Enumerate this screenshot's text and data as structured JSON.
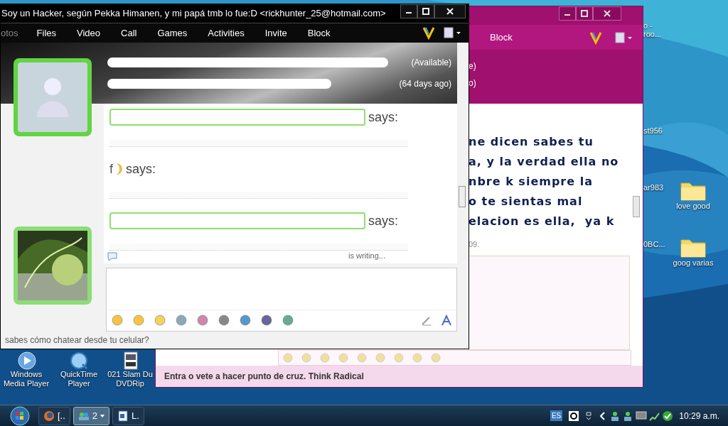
{
  "desktop_icons_right": [
    {
      "label": "o -\nroo...",
      "kind": "partial"
    },
    {
      "label": "st956",
      "kind": "partial"
    },
    {
      "label": "ar983",
      "kind": "partial"
    },
    {
      "label": "love good",
      "kind": "folder"
    },
    {
      "label": "0BC...",
      "kind": "partial"
    },
    {
      "label": "goog varias",
      "kind": "folder"
    }
  ],
  "desktop_icons_left": [
    {
      "label": "Windows Media Player",
      "kind": "media"
    },
    {
      "label": "QuickTime Player",
      "kind": "quicktime"
    },
    {
      "label": "021 Slam Du DVDRip",
      "kind": "video"
    }
  ],
  "back_window": {
    "menu": [
      "Block"
    ],
    "status_lines": [
      "e)",
      "o)"
    ],
    "message_lines": [
      "ne dicen sabes tu",
      "a, y la verdad ella no",
      "nbre k siempre la",
      "o te sientas mal",
      "elacion es ella,  ya k"
    ],
    "timestamp": "09.",
    "footer": "Entra o vete a hacer punto de cruz. Think Radical"
  },
  "front_window": {
    "title": "Soy un Hacker, según Pekka Himanen, y mi papá tmb lo fue:D <rickhunter_25@hotmail.com>",
    "menu": [
      {
        "label": "otos"
      },
      {
        "label": "Files"
      },
      {
        "label": "Video"
      },
      {
        "label": "Call"
      },
      {
        "label": "Games"
      },
      {
        "label": "Activities"
      },
      {
        "label": "Invite"
      },
      {
        "label": "Block"
      }
    ],
    "contact_status": "(Available)",
    "last_seen": "(64 days ago)",
    "messages": [
      {
        "says": "says:",
        "highlight": true
      },
      {
        "prefix": "f",
        "says": "says:",
        "highlight": false
      },
      {
        "says": "says:",
        "highlight": true
      }
    ],
    "typing": "is writing...",
    "footer": "sabes cómo chatear desde tu celular?"
  },
  "taskbar": {
    "buttons": [
      {
        "label": "[..",
        "kind": "firefox",
        "selected": false
      },
      {
        "label": "2",
        "kind": "messenger",
        "selected": true
      },
      {
        "label": "L.",
        "kind": "word",
        "selected": false
      }
    ],
    "language": "ES",
    "clock": "10:29 a.m."
  }
}
